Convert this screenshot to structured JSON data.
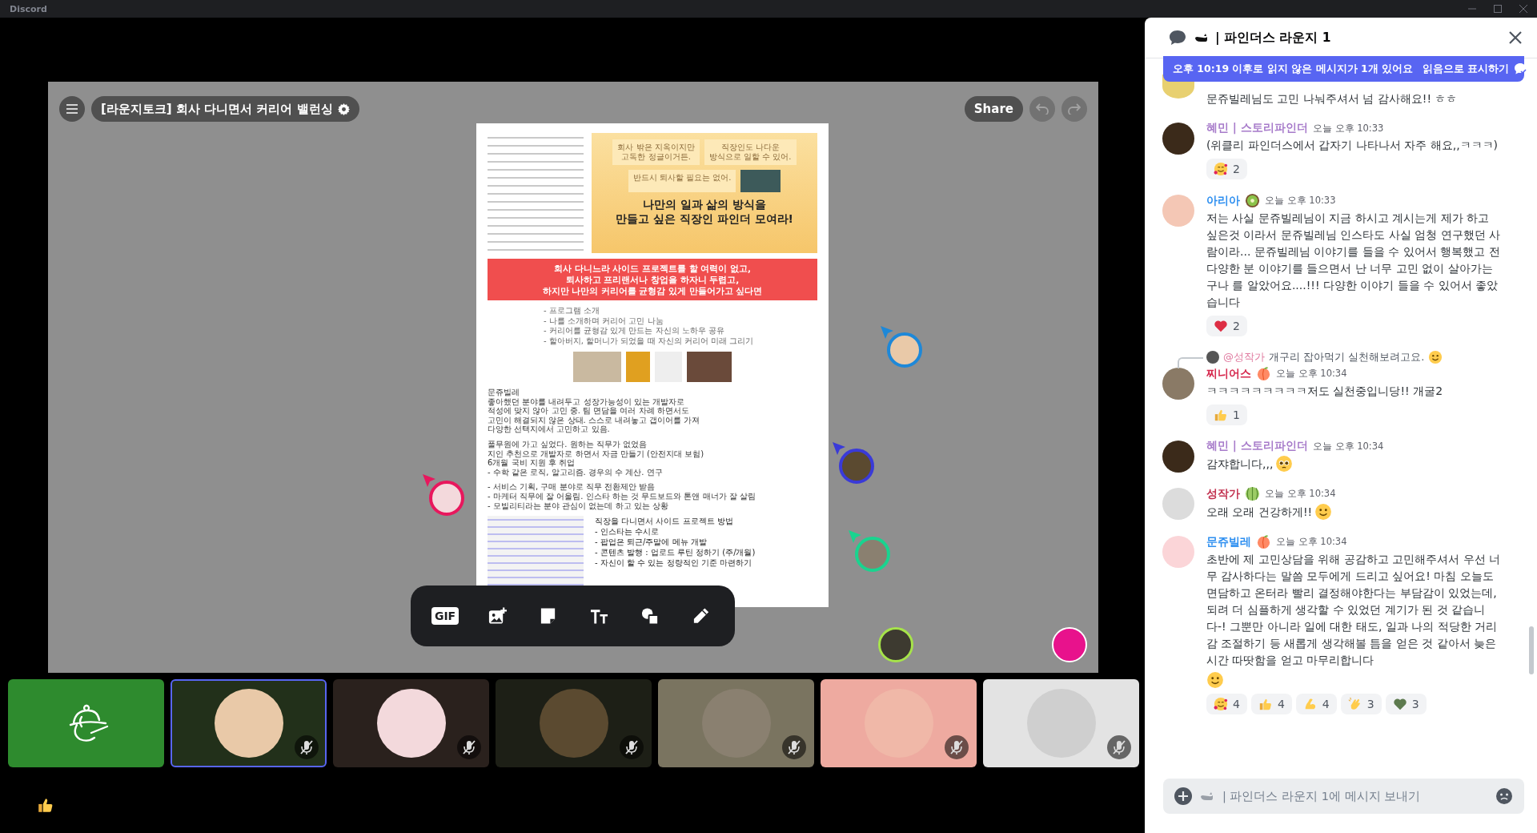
{
  "window": {
    "title": "Discord"
  },
  "board": {
    "title": "[라운지토크] 회사 다니면서 커리어 밸런싱",
    "share": "Share",
    "undo": {
      "disabled": true
    },
    "redo": {
      "disabled": true
    },
    "document": {
      "bubbles": [
        [
          "회사 밖은 지옥이지만",
          "고독한 정글이거든."
        ],
        [
          "직장인도 나다운",
          "방식으로 일할 수 있어."
        ],
        [
          "반드시 퇴사할 필요는 없어."
        ]
      ],
      "headline": [
        "나만의 일과 삶의 방식을",
        "만들고 싶은 직장인 파인더 모여라!"
      ],
      "banner": [
        "회사 다니느라 사이드 프로젝트를 할 여력이 없고,",
        "퇴사하고 프리랜서나 창업을 하자니 두렵고,",
        "하지만 나만의 커리어를 균형감 있게 만들어가고 싶다면"
      ],
      "agenda": [
        "- 프로그램 소개",
        "- 나를 소개하며 커리어 고민 나눔",
        "- 커리어를 균형감 있게 만드는 자신의 노하우 공유",
        "- 할아버지, 할머니가 되었을 때 자신의 커리어 미래 그리기"
      ],
      "notes": [
        [
          "문쥬빌레",
          "좋아했던 분야를 내려두고 성장가능성이 있는 개발자로",
          "적성에 맞지 않아 고민 중. 팀 면담을 여러 차례 하면서도",
          "고민이 해결되지 않은 상태. 스스로 내려놓고 갭이어를 가져",
          "다양한 선택지에서 고민하고 있음."
        ],
        [
          "풀무원에 가고 싶었다. 원하는 직무가 없었음",
          "지인 추천으로 개발자로 하면서 자금 만들기 (안전지대 보험)",
          "6개월 국비 지원 후 취업",
          "- 수학 같은 로직, 알고리즘. 경우의 수 계산. 연구"
        ],
        [
          "- 서비스 기획, 구매 분야로 직무 전환제안 받음",
          "- 마케터 직무에 잘 어울림. 인스타 하는 것 무드보드와 톤앤 매너가 잘 살림",
          "- 모빌리티라는 분야 관심이 없는데 하고 있는 상황"
        ]
      ],
      "side_project": {
        "title": "직장을 다니면서 사이드 프로젝트 방법",
        "items": [
          "- 인스타는 수시로",
          "- 팝업은 퇴근/주말에 메뉴 개발",
          "- 콘텐츠 발행 : 업로드 루틴 정하기 (주/개월)",
          "- 자신이 할 수 있는 정량적인 기준 마련하기"
        ]
      }
    },
    "cursors": [
      {
        "color": "#1e88d8"
      },
      {
        "color": "#e8175d"
      },
      {
        "color": "#3a3ad8"
      },
      {
        "color": "#19d48f"
      }
    ],
    "presence": [
      {
        "kind": "photo",
        "color": "#a6e34a"
      },
      {
        "kind": "solid",
        "color": "#e8128c"
      }
    ],
    "tools": [
      {
        "kind": "gif",
        "label": "GIF"
      },
      {
        "kind": "image"
      },
      {
        "kind": "sticky"
      },
      {
        "kind": "text"
      },
      {
        "kind": "shapes"
      },
      {
        "kind": "pen"
      }
    ]
  },
  "tiles": [
    {
      "kind": "logo",
      "color": "#2e8b2e",
      "selected": false,
      "muted": false
    },
    {
      "kind": "avatar",
      "color": "#22301a",
      "selected": true,
      "muted": true
    },
    {
      "kind": "avatar",
      "color": "#2a211d",
      "selected": false,
      "muted": true
    },
    {
      "kind": "avatar",
      "color": "#1d1f16",
      "selected": false,
      "muted": true
    },
    {
      "kind": "avatar",
      "color": "#7a7460",
      "selected": false,
      "muted": true
    },
    {
      "kind": "avatar",
      "color": "#eeaaa0",
      "selected": false,
      "muted": true
    },
    {
      "kind": "avatar",
      "color": "#e3e3e3",
      "selected": false,
      "muted": true
    }
  ],
  "chat": {
    "title": "| 파인더스 라운지 1",
    "banner": {
      "text": "오후 10:19 이후로 읽지 않은 메시지가 1개 있어요",
      "action": "읽음으로 표시하기"
    },
    "messages": [
      {
        "kind": "continuation",
        "text": "문쥬빌레님도 고민 나눠주셔서 넘 감사해요!! ㅎㅎ"
      },
      {
        "kind": "message",
        "author": "혜민 | 스토리파인더",
        "color": "#a77bca",
        "time": "오늘 오후 10:33",
        "text": "(위클리 파인더스에서 갑자기 나타나서 자주 해요,,ㅋㅋㅋ)",
        "reactions": [
          {
            "kind": "hug-face",
            "count": "2"
          }
        ]
      },
      {
        "kind": "message",
        "author": "아리아",
        "color": "#2e8ff0",
        "badge": {
          "kind": "kiwi"
        },
        "time": "오늘 오후 10:33",
        "text": "저는 사실 문쥬빌레님이 지금 하시고 계시는게 제가 하고 싶은것 이라서 문쥬빌레님 인스타도 사실 엄청 연구했던 사람이라... 문쥬빌레님 이야기를 들을 수 있어서 행복했고 전 다양한 분 이야기를 들으면서 난 너무 고민 없이 살아가는 구나 를 알았어요....!!! 다양한 이야기 들을 수 있어서 좋았습니다",
        "reactions": [
          {
            "kind": "heart",
            "count": "2"
          }
        ]
      },
      {
        "kind": "message",
        "reply": {
          "mention": "@성작가",
          "text": "개구리 잡아먹기 실천해보려고요.",
          "emoji": {
            "kind": "smile"
          }
        },
        "author": "찌니어스",
        "color": "#d6284d",
        "badge": {
          "kind": "peach"
        },
        "time": "오늘 오후 10:34",
        "text": "ㅋㅋㅋㅋㅋㅋㅋㅋㅋ저도 실천중입니당!! 개굴2",
        "reactions": [
          {
            "kind": "thumbs-up",
            "count": "1"
          }
        ]
      },
      {
        "kind": "message",
        "author": "혜민 | 스토리파인더",
        "color": "#a77bca",
        "time": "오늘 오후 10:34",
        "text": "감쟈합니다,,,",
        "end_emoji": {
          "kind": "pleading"
        }
      },
      {
        "kind": "message",
        "author": "성작가",
        "color": "#c2314f",
        "badge": {
          "kind": "melon"
        },
        "time": "오늘 오후 10:34",
        "text": "오래 오래 건강하게!!",
        "end_emoji": {
          "kind": "smile"
        }
      },
      {
        "kind": "message",
        "author": "문쥬빌레",
        "color": "#2e8ff0",
        "badge": {
          "kind": "peach"
        },
        "time": "오늘 오후 10:34",
        "text": "초반에 제 고민상담을 위해 공감하고 고민해주셔서 우선 너무 감사하다는 말씀 모두에게 드리고 싶어요! 마침 오늘도 면담하고 온터라 빨리 결정해야한다는 부담감이 있었는데, 되려 더 심플하게 생각할 수 있었던 계기가 된 것 같습니다-! 그뿐만 아니라 일에 대한 태도, 일과 나의 적당한 거리감 조절하기 등 새롭게 생각해볼 틈을 얻은 것 같아서 늦은 시간 따땃함을 얻고 마무리합니다",
        "end_emoji": {
          "kind": "smile"
        },
        "reactions": [
          {
            "kind": "hug-face",
            "count": "4"
          },
          {
            "kind": "thumbs-up",
            "count": "4"
          },
          {
            "kind": "muscle",
            "count": "4"
          },
          {
            "kind": "clap",
            "count": "3"
          },
          {
            "kind": "green-heart",
            "count": "3"
          }
        ]
      }
    ],
    "input": {
      "placeholder": "| 파인더스 라운지 1에 메시지 보내기"
    }
  }
}
